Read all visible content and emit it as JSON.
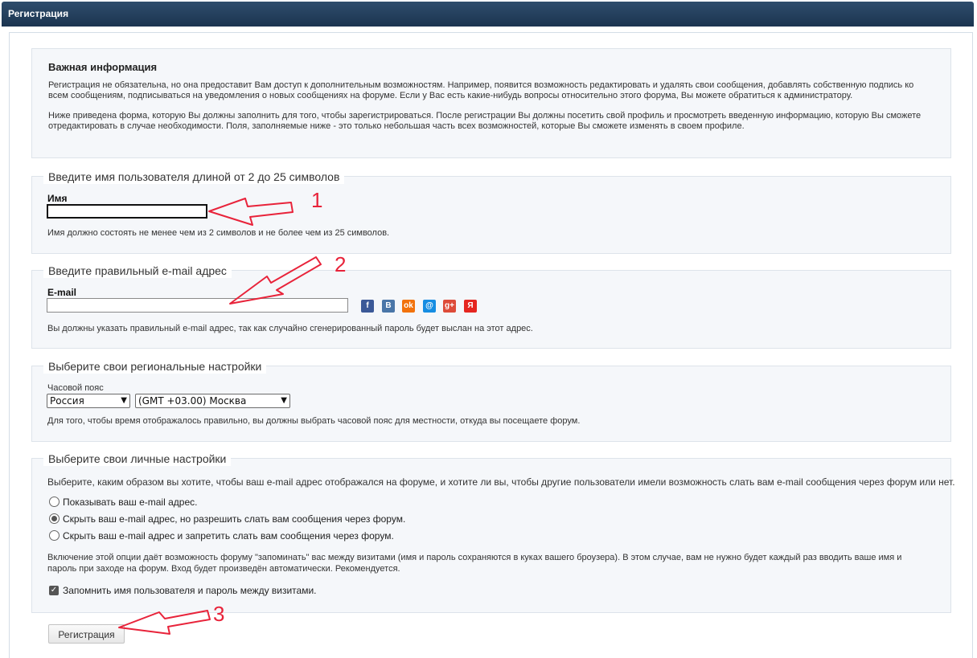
{
  "header": {
    "title": "Регистрация"
  },
  "info": {
    "title": "Важная информация",
    "p1": "Регистрация не обязательна, но она предоставит Вам доступ к дополнительным возможностям. Например, появится возможность редактировать и удалять свои сообщения, добавлять собственную подпись ко всем сообщениям, подписываться на уведомления о новых сообщениях на форуме. Если у Вас есть какие-нибудь вопросы относительно этого форума, Вы можете обратиться к администратору.",
    "p2": "Ниже приведена форма, которую Вы должны заполнить для того, чтобы зарегистрироваться. После регистрации Вы должны посетить свой профиль и просмотреть введенную информацию, которую Вы сможете отредактировать в случае необходимости. Поля, заполняемые ниже - это только небольшая часть всех возможностей, которые Вы сможете изменять в своем профиле."
  },
  "username": {
    "legend": "Введите имя пользователя длиной от 2 до 25 символов",
    "label": "Имя",
    "value": "",
    "hint": "Имя должно состоять не менее чем из 2 символов и не более чем из 25 символов."
  },
  "email": {
    "legend": "Введите правильный e-mail адрес",
    "label": "E-mail",
    "value": "",
    "hint": "Вы должны указать правильный e-mail адрес, так как случайно сгенерированный пароль будет выслан на этот адрес.",
    "social": [
      {
        "icon": "facebook-icon",
        "glyph": "f",
        "color": "#3b5998"
      },
      {
        "icon": "vkontakte-icon",
        "glyph": "B",
        "color": "#4a76a8"
      },
      {
        "icon": "odnoklassniki-icon",
        "glyph": "ok",
        "color": "#f2720c"
      },
      {
        "icon": "mailru-icon",
        "glyph": "@",
        "color": "#168de2"
      },
      {
        "icon": "google-plus-icon",
        "glyph": "g+",
        "color": "#dd4b39"
      },
      {
        "icon": "yandex-icon",
        "glyph": "Я",
        "color": "#e52620"
      }
    ]
  },
  "region": {
    "legend": "Выберите свои региональные настройки",
    "tz_label": "Часовой пояс",
    "country": "Россия",
    "timezone": "(GMT +03.00) Москва",
    "hint": "Для того, чтобы время отображалось правильно, вы должны выбрать часовой пояс для местности, откуда вы посещаете форум."
  },
  "personal": {
    "legend": "Выберите свои личные настройки",
    "intro": "Выберите, каким образом вы хотите, чтобы ваш e-mail адрес отображался на форуме, и хотите ли вы, чтобы другие пользователи имели возможность слать вам e-mail сообщения через форум или нет.",
    "options": [
      {
        "label": "Показывать ваш e-mail адрес.",
        "checked": false
      },
      {
        "label": "Скрыть ваш e-mail адрес, но разрешить слать вам сообщения через форум.",
        "checked": true
      },
      {
        "label": "Скрыть ваш e-mail адрес и запретить слать вам сообщения через форум.",
        "checked": false
      }
    ],
    "remember_note": "Включение этой опции даёт возможность форуму \"запоминать\" вас между визитами (имя и пароль сохраняются в куках вашего броузера). В этом случае, вам не нужно будет каждый раз вводить ваше имя и пароль при заходе на форум. Вход будет произведён автоматически. Рекомендуется.",
    "remember_label": "Запомнить имя пользователя и пароль между визитами.",
    "remember_checked": true
  },
  "submit_label": "Регистрация",
  "annotations": {
    "n1": "1",
    "n2": "2",
    "n3": "3",
    "color": "#e8233a"
  }
}
